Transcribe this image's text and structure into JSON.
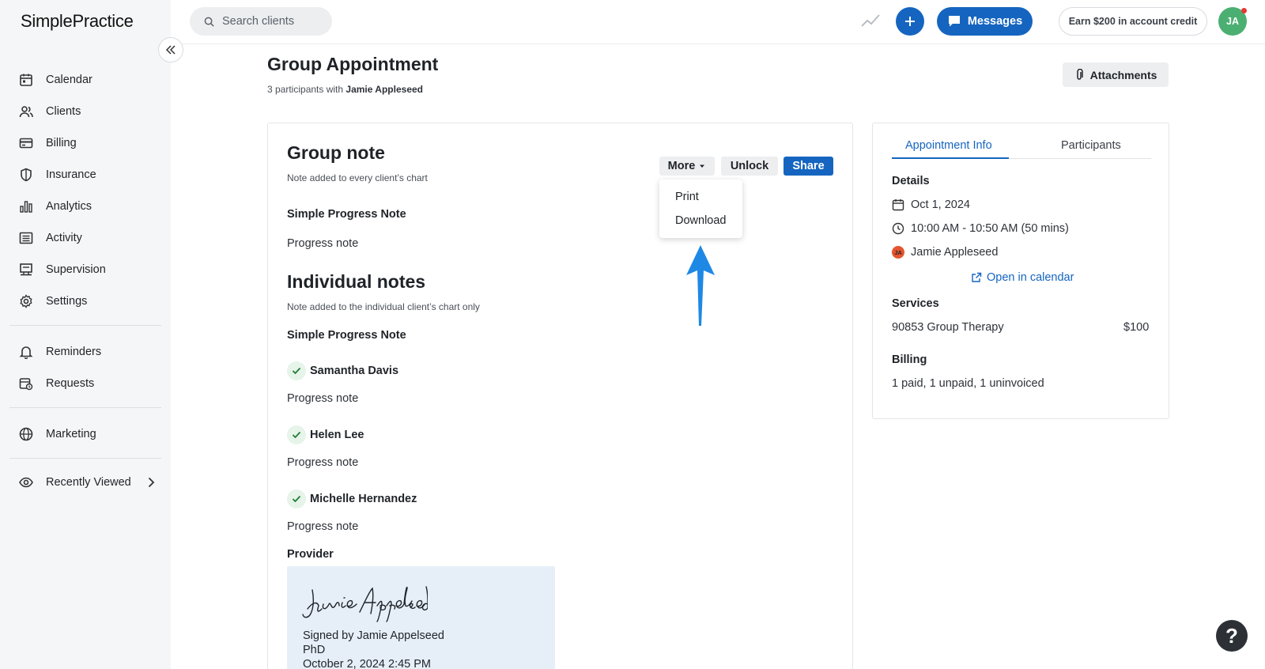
{
  "app": {
    "logo_text": "SimplePractice"
  },
  "sidebar": {
    "items": [
      {
        "label": "Calendar",
        "icon": "calendar-icon"
      },
      {
        "label": "Clients",
        "icon": "users-icon"
      },
      {
        "label": "Billing",
        "icon": "credit-card-icon"
      },
      {
        "label": "Insurance",
        "icon": "shield-icon"
      },
      {
        "label": "Analytics",
        "icon": "bar-chart-icon"
      },
      {
        "label": "Activity",
        "icon": "list-icon"
      },
      {
        "label": "Supervision",
        "icon": "supervision-icon"
      },
      {
        "label": "Settings",
        "icon": "gear-icon"
      },
      {
        "label": "Reminders",
        "icon": "bell-icon"
      },
      {
        "label": "Requests",
        "icon": "calendar-clock-icon"
      },
      {
        "label": "Marketing",
        "icon": "globe-icon"
      },
      {
        "label": "Recently Viewed",
        "icon": "eye-icon"
      }
    ]
  },
  "topbar": {
    "search_placeholder": "Search clients",
    "messages_label": "Messages",
    "credit_label": "Earn $200 in account credit",
    "avatar_initials": "JA"
  },
  "header": {
    "title": "Group Appointment",
    "subtitle_prefix": "3 participants with ",
    "subtitle_name": "Jamie Appleseed",
    "attachments_label": "Attachments"
  },
  "group_note": {
    "title": "Group note",
    "hint": "Note added to every client’s chart",
    "more_label": "More",
    "unlock_label": "Unlock",
    "share_label": "Share",
    "menu": [
      "Print",
      "Download"
    ],
    "template_title": "Simple Progress Note",
    "body": "Progress note"
  },
  "individual_notes": {
    "title": "Individual notes",
    "hint": "Note added to the individual client’s chart only",
    "template_title": "Simple Progress Note",
    "clients": [
      {
        "name": "Samantha Davis",
        "note": "Progress note"
      },
      {
        "name": "Helen Lee",
        "note": "Progress note"
      },
      {
        "name": "Michelle Hernandez",
        "note": "Progress note"
      }
    ]
  },
  "provider": {
    "label": "Provider",
    "signature_script": "Jamie Appelseed",
    "signed_by": "Signed by Jamie Appelseed",
    "credential": "PhD",
    "signed_at": "October 2, 2024 2:45 PM"
  },
  "info_panel": {
    "tabs": [
      "Appointment Info",
      "Participants"
    ],
    "details_label": "Details",
    "date": "Oct 1, 2024",
    "time": "10:00 AM - 10:50 AM (50 mins)",
    "clinician_initials": "JA",
    "clinician": "Jamie Appleseed",
    "open_calendar": "Open in calendar",
    "services_label": "Services",
    "service_name": "90853 Group Therapy",
    "service_price": "$100",
    "billing_label": "Billing",
    "billing_status": "1 paid, 1 unpaid, 1 uninvoiced"
  },
  "help_label": "?",
  "colors": {
    "primary": "#1565c0",
    "arrow": "#1e88e5",
    "avatar": "#4caf72",
    "sidebar_bg": "#f5f6f7"
  }
}
